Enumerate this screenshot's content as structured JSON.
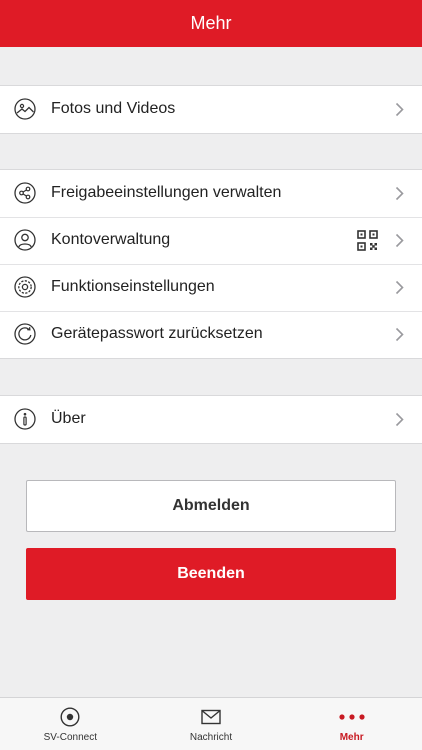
{
  "header": {
    "title": "Mehr"
  },
  "groups": [
    {
      "items": [
        {
          "label": "Fotos und Videos",
          "icon": "photo-icon"
        }
      ]
    },
    {
      "items": [
        {
          "label": "Freigabeeinstellungen verwalten",
          "icon": "share-icon"
        },
        {
          "label": "Kontoverwaltung",
          "icon": "account-icon",
          "extra_icon": "qr-code-icon"
        },
        {
          "label": "Funktionseinstellungen",
          "icon": "function-settings-icon"
        },
        {
          "label": "Gerätepasswort zurücksetzen",
          "icon": "reset-password-icon"
        }
      ]
    },
    {
      "items": [
        {
          "label": "Über",
          "icon": "info-icon"
        }
      ]
    }
  ],
  "buttons": {
    "logout": "Abmelden",
    "quit": "Beenden"
  },
  "tabbar": {
    "tabs": [
      {
        "label": "SV-Connect",
        "icon": "sv-connect-icon",
        "active": false
      },
      {
        "label": "Nachricht",
        "icon": "mail-icon",
        "active": false
      },
      {
        "label": "Mehr",
        "icon": "more-dots-icon",
        "active": true
      }
    ]
  },
  "colors": {
    "accent": "#df1b26",
    "background": "#eeeeef",
    "text": "#222222"
  }
}
